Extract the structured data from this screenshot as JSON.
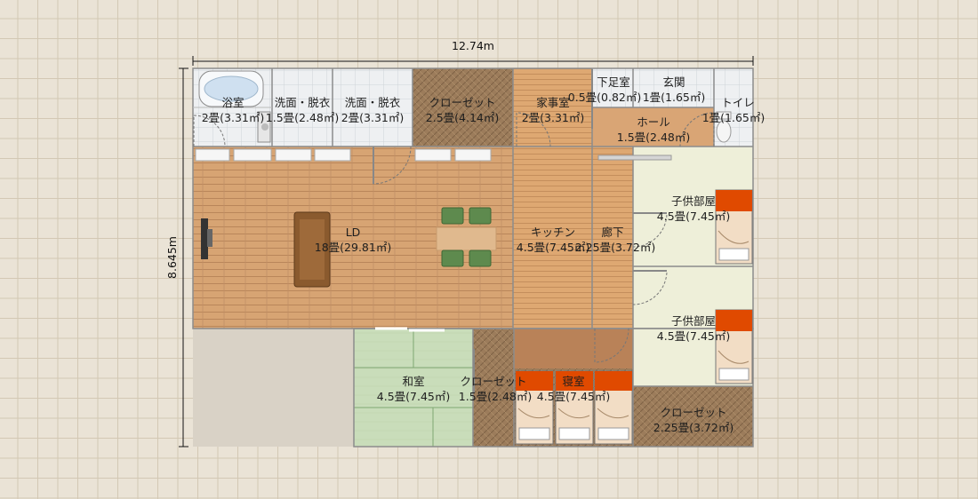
{
  "dimensions": {
    "width_label": "12.74m",
    "height_label": "8.645m"
  },
  "rooms": {
    "bath": {
      "name": "浴室",
      "size": "2畳(3.31㎡)"
    },
    "wash1": {
      "name": "洗面・脱衣",
      "size": "1.5畳(2.48㎡)"
    },
    "wash2": {
      "name": "洗面・脱衣",
      "size": "2畳(3.31㎡)"
    },
    "closet_top": {
      "name": "クローゼット",
      "size": "2.5畳(4.14㎡)"
    },
    "utility": {
      "name": "家事室",
      "size": "2畳(3.31㎡)"
    },
    "shoe_room": {
      "name": "下足室",
      "size": "0.5畳(0.82㎡)"
    },
    "entrance": {
      "name": "玄関",
      "size": "1畳(1.65㎡)"
    },
    "toilet": {
      "name": "トイレ",
      "size": "1畳(1.65㎡)"
    },
    "hall": {
      "name": "ホール",
      "size": "1.5畳(2.48㎡)"
    },
    "ld": {
      "name": "LD",
      "size": "18畳(29.81㎡)"
    },
    "kitchen": {
      "name": "キッチン",
      "size": "4.5畳(7.45㎡)"
    },
    "corridor": {
      "name": "廊下",
      "size": "2.25畳(3.72㎡)"
    },
    "kids1": {
      "name": "子供部屋",
      "size": "4.5畳(7.45㎡)"
    },
    "kids2": {
      "name": "子供部屋",
      "size": "4.5畳(7.45㎡)"
    },
    "washitsu": {
      "name": "和室",
      "size": "4.5畳(7.45㎡)"
    },
    "closet_mid": {
      "name": "クローゼット",
      "size": "1.5畳(2.48㎡)"
    },
    "bedroom": {
      "name": "寝室",
      "size": "4.5畳(7.45㎡)"
    },
    "closet_br": {
      "name": "クローゼット",
      "size": "2.25畳(3.72㎡)"
    }
  },
  "colors": {
    "wood": "#d9a575",
    "dark_wood": "#9a7a58",
    "tatami": "#c8dcb8",
    "carpet": "#eeefd9",
    "wall": "#8a8a8a",
    "bed_cover": "#e04a00",
    "sofa": "#8a5a2e",
    "chair": "#5e8a4e"
  }
}
